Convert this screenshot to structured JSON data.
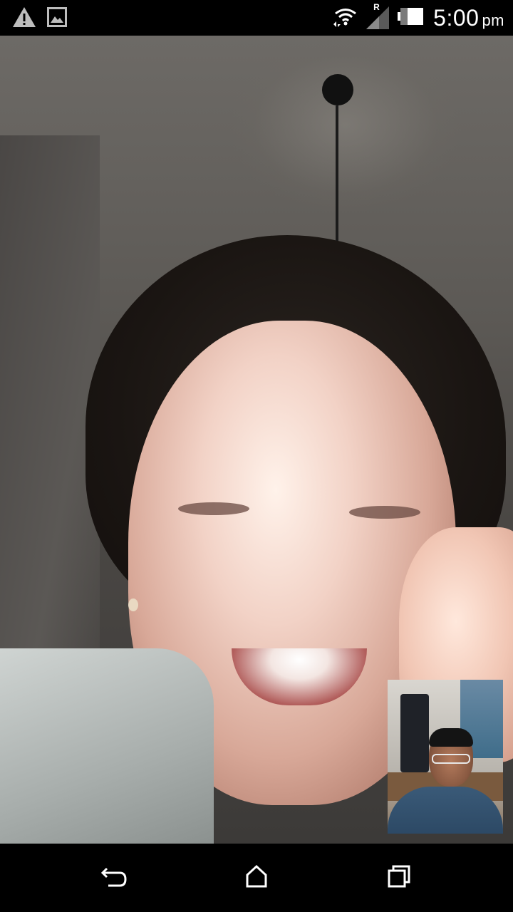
{
  "status_bar": {
    "time": "5:00",
    "ampm": "pm",
    "roaming_indicator": "R",
    "icons": [
      "warning-icon",
      "image-notification-icon",
      "wifi-icon",
      "cell-signal-icon",
      "battery-icon"
    ]
  },
  "call": {
    "remote_video": "remote-video-feed",
    "self_view": "self-view-feed"
  },
  "nav_bar": {
    "buttons": [
      "back-icon",
      "home-icon",
      "recent-apps-icon"
    ]
  },
  "colors": {
    "status_bar_bg": "#000000",
    "nav_bar_bg": "#000000",
    "icon_color": "#ffffff"
  }
}
